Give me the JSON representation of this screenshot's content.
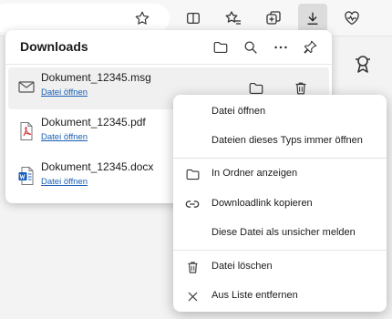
{
  "toolbar": {
    "buttons": [
      {
        "name": "favorite-star"
      },
      {
        "name": "split-screen"
      },
      {
        "name": "favorites"
      },
      {
        "name": "collections"
      },
      {
        "name": "downloads"
      },
      {
        "name": "browser-essentials"
      }
    ]
  },
  "downloads": {
    "title": "Downloads",
    "items": [
      {
        "name": "Dokument_12345.msg",
        "link": "Datei öffnen",
        "icon": "mail-file-icon"
      },
      {
        "name": "Dokument_12345.pdf",
        "link": "Datei öffnen",
        "icon": "pdf-file-icon"
      },
      {
        "name": "Dokument_12345.docx",
        "link": "Datei öffnen",
        "icon": "word-file-icon"
      }
    ]
  },
  "context_menu": {
    "items": [
      {
        "label": "Datei öffnen",
        "icon": ""
      },
      {
        "label": "Dateien dieses Typs immer öffnen",
        "icon": ""
      },
      {
        "label": "In Ordner anzeigen",
        "icon": "folder-icon"
      },
      {
        "label": "Downloadlink kopieren",
        "icon": "link-icon"
      },
      {
        "label": "Diese Datei als unsicher melden",
        "icon": ""
      },
      {
        "label": "Datei löschen",
        "icon": "trash-icon"
      },
      {
        "label": "Aus Liste entfernen",
        "icon": "close-icon"
      }
    ]
  },
  "colors": {
    "link": "#1a5fb4",
    "active_button": "#dcdcdc",
    "pdf_red": "#d13438",
    "word_blue": "#185abd"
  }
}
